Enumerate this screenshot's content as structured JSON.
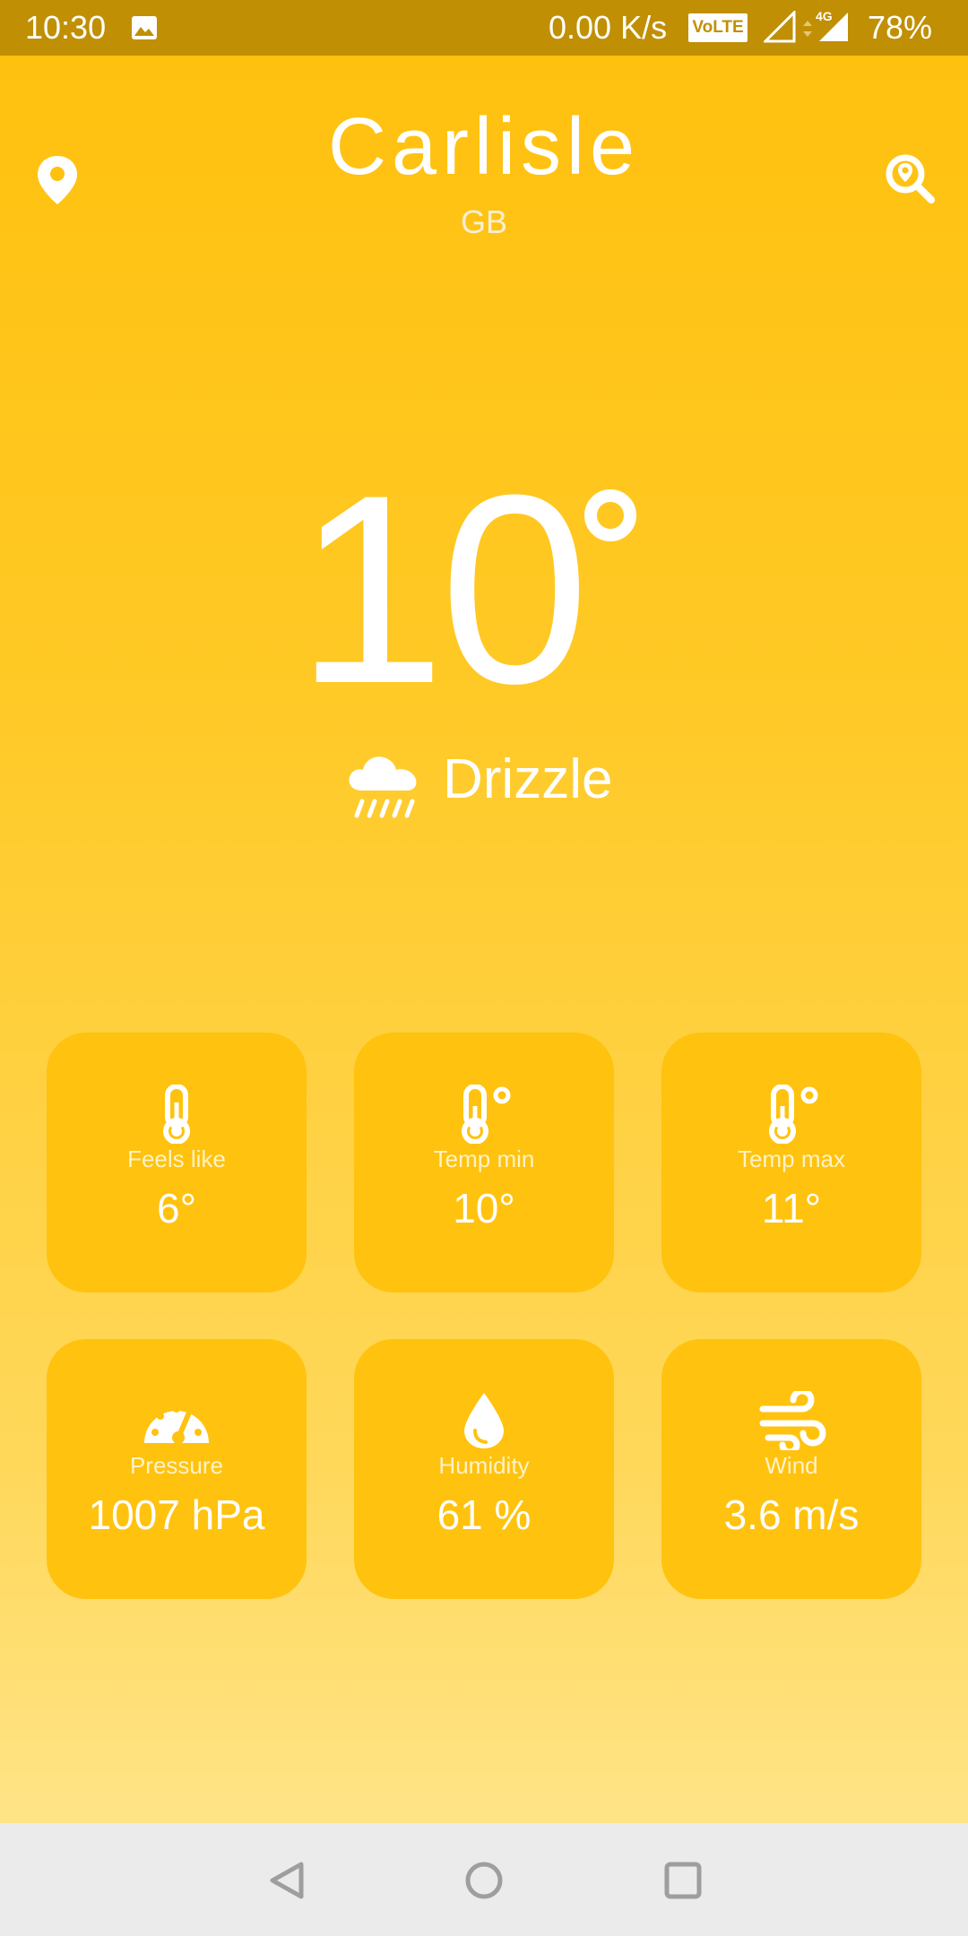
{
  "status_bar": {
    "time": "10:30",
    "network_speed": "0.00 K/s",
    "volte": "VoLTE",
    "network_type": "4G",
    "battery": "78%"
  },
  "header": {
    "city": "Carlisle",
    "country": "GB",
    "location_icon": "map-pin-icon",
    "search_icon": "search-location-icon"
  },
  "current": {
    "temperature": "10",
    "condition": "Drizzle",
    "condition_icon": "drizzle-cloud-icon"
  },
  "details": [
    {
      "label": "Feels like",
      "value": "6°",
      "icon": "thermometer-icon"
    },
    {
      "label": "Temp min",
      "value": "10°",
      "icon": "thermometer-celsius-icon"
    },
    {
      "label": "Temp max",
      "value": "11°",
      "icon": "thermometer-celsius-icon"
    },
    {
      "label": "Pressure",
      "value": "1007 hPa",
      "icon": "gauge-icon"
    },
    {
      "label": "Humidity",
      "value": "61 %",
      "icon": "droplet-icon"
    },
    {
      "label": "Wind",
      "value": "3.6 m/s",
      "icon": "wind-icon"
    }
  ],
  "colors": {
    "status_bar": "#C08F04",
    "background_top": "#FFC10F",
    "background_bottom": "#FFE487",
    "tile": "#FFC20E",
    "nav_bar": "#EBEBEB"
  }
}
